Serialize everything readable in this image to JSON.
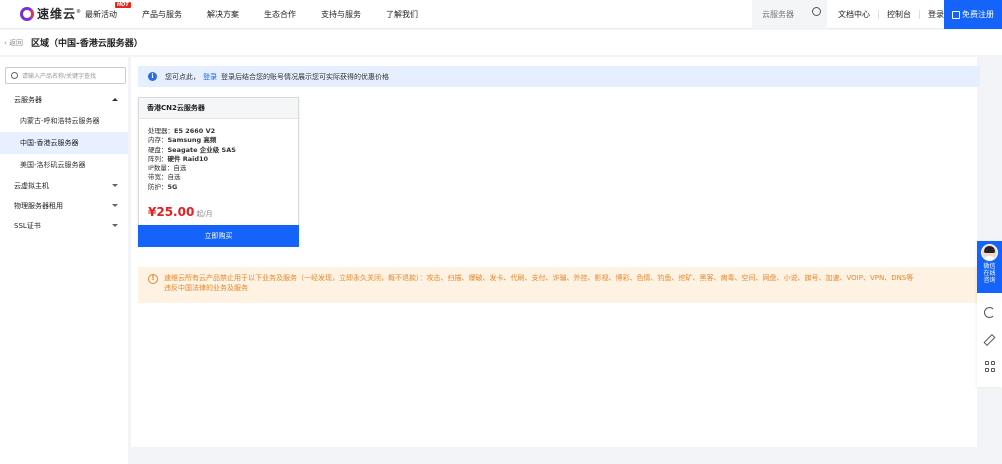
{
  "brand": {
    "name": "速维云",
    "registered": "®"
  },
  "nav": {
    "items": [
      {
        "label": "最新活动",
        "badge": "HOT"
      },
      {
        "label": "产品与服务"
      },
      {
        "label": "解决方案"
      },
      {
        "label": "生态合作"
      },
      {
        "label": "支持与服务"
      },
      {
        "label": "了解我们"
      }
    ]
  },
  "header": {
    "search_placeholder": "云服务器",
    "links": [
      "文档中心",
      "控制台",
      "登录"
    ],
    "register_label": "免费注册"
  },
  "breadcrumb": {
    "back_label": "返回",
    "title": "区域（中国-香港云服务器）"
  },
  "sidebar": {
    "search_placeholder": "请输入产品名称/关键字查找",
    "groups": [
      {
        "label": "云服务器",
        "expanded": true,
        "items": [
          {
            "label": "内蒙古-呼和浩特云服务器",
            "active": false
          },
          {
            "label": "中国-香港云服务器",
            "active": true
          },
          {
            "label": "美国-洛杉矶云服务器",
            "active": false
          }
        ]
      },
      {
        "label": "云虚拟主机",
        "expanded": false
      },
      {
        "label": "物理服务器租用",
        "expanded": false
      },
      {
        "label": "SSL证书",
        "expanded": false
      }
    ]
  },
  "info_bar": {
    "prefix": "您可点此，",
    "login_label": "登录",
    "suffix": "登录后结合您的账号情况展示您可实际获得的优惠价格"
  },
  "product": {
    "title": "香港CN2云服务器",
    "specs": [
      {
        "label": "处理器：",
        "value": "E5 2660 V2"
      },
      {
        "label": "内存：",
        "value": "Samsung 高频"
      },
      {
        "label": "硬盘：",
        "value": "Seagate 企业级 SAS"
      },
      {
        "label": "阵列：",
        "value": "硬件 Raid10"
      },
      {
        "label": "IP数量：",
        "value": "自选"
      },
      {
        "label": "带宽：",
        "value": "自选"
      },
      {
        "label": "防护：",
        "value": "5G"
      }
    ],
    "price": "¥25.00",
    "price_unit": "起/月",
    "buy_label": "立即购买"
  },
  "notice": {
    "line1": "速维云所有云产品禁止用于以下业务及服务（一经发现，立即永久关闭，概不退款）：攻击、扫描、爆破、发卡、代刷、支付、诈骗、外挂、影视、博彩、色情、钓鱼、挖矿、黑客、病毒、空间、网盘、小说、旗号、加速、VOIP、VPN、DNS等",
    "line2": "违反中国法律的业务及服务"
  },
  "float": {
    "consult_label": "微信在线咨询"
  },
  "colors": {
    "accent": "#1464fb",
    "price": "#e5201d",
    "notice": "#e9872e"
  }
}
